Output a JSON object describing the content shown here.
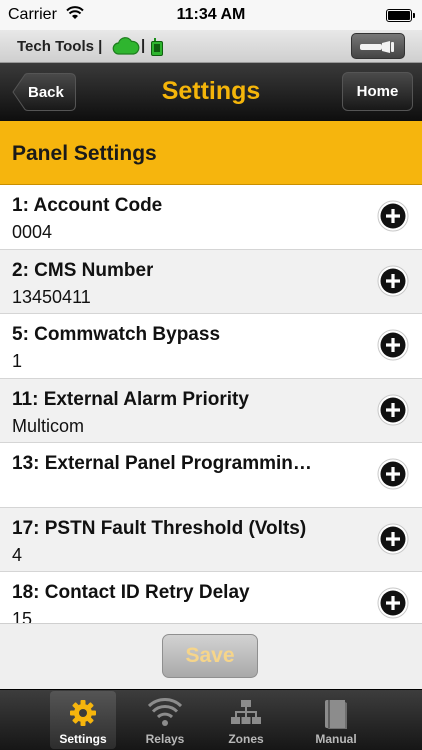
{
  "status_bar": {
    "carrier": "Carrier",
    "time": "11:34 AM"
  },
  "tools_bar": {
    "label": "Tech Tools |",
    "separator": "|"
  },
  "nav": {
    "back_label": "Back",
    "title": "Settings",
    "home_label": "Home"
  },
  "section": {
    "title": "Panel Settings"
  },
  "settings": [
    {
      "title": "1: Account Code",
      "value": "0004"
    },
    {
      "title": "2: CMS Number",
      "value": "13450411"
    },
    {
      "title": "5: Commwatch Bypass",
      "value": "1"
    },
    {
      "title": "11: External Alarm Priority",
      "value": "Multicom"
    },
    {
      "title": "13: External Panel Programmin…",
      "value": ""
    },
    {
      "title": "17: PSTN Fault Threshold (Volts)",
      "value": "4"
    },
    {
      "title": "18: Contact ID Retry Delay",
      "value": "15"
    }
  ],
  "save_label": "Save",
  "tabs": [
    {
      "label": "Settings",
      "icon": "gear-icon",
      "active": true
    },
    {
      "label": "Relays",
      "icon": "wifi-icon",
      "active": false
    },
    {
      "label": "Zones",
      "icon": "network-icon",
      "active": false
    },
    {
      "label": "Manual",
      "icon": "book-icon",
      "active": false
    }
  ],
  "colors": {
    "accent": "#f6b50d",
    "title": "#f5b50a",
    "cloud": "#2fb52f"
  }
}
